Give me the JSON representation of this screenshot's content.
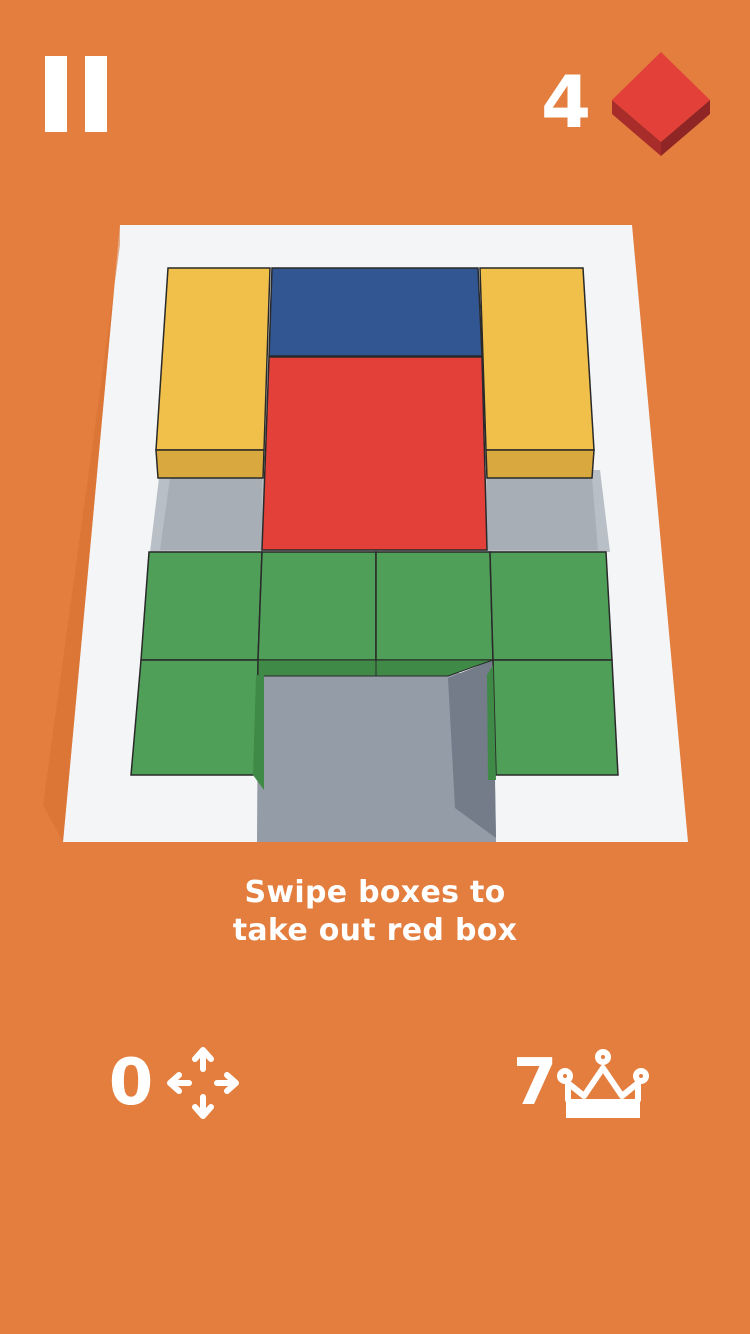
{
  "hud": {
    "level": "4"
  },
  "instruction": {
    "line1": "Swipe boxes to",
    "line2": "take out red box"
  },
  "stats": {
    "moves": "0",
    "best": "7"
  },
  "icons": {
    "pause": "pause-icon",
    "level": "red-box-icon",
    "moves": "move-arrows-icon",
    "best": "crown-icon"
  },
  "colors": {
    "background": "#E37E3E",
    "board": "#F3F5F7",
    "red_box": "#E3403A",
    "blue_box": "#315692",
    "yellow_box": "#F1C04B",
    "green_box": "#4F9F58",
    "exit_slot": "#939CA7"
  },
  "board": {
    "boxes": [
      {
        "name": "yellow-box-left",
        "color": "yellow"
      },
      {
        "name": "blue-box",
        "color": "blue"
      },
      {
        "name": "yellow-box-right",
        "color": "yellow"
      },
      {
        "name": "red-box",
        "color": "red"
      },
      {
        "name": "green-box-1",
        "color": "green"
      },
      {
        "name": "green-box-2",
        "color": "green"
      },
      {
        "name": "green-box-3",
        "color": "green"
      },
      {
        "name": "green-box-4",
        "color": "green"
      },
      {
        "name": "green-box-5",
        "color": "green"
      },
      {
        "name": "green-box-6",
        "color": "green"
      }
    ]
  }
}
